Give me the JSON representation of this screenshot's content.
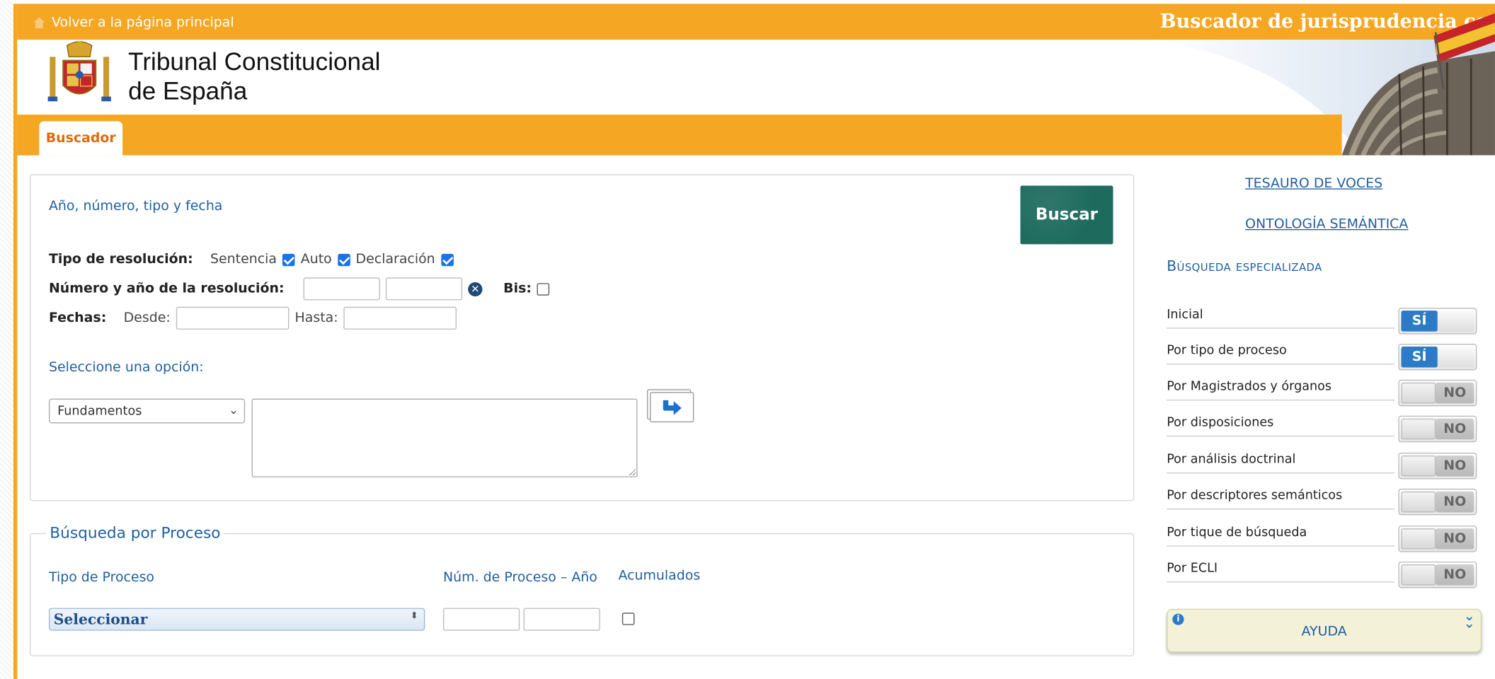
{
  "topbar": {
    "home_link": "Volver a la página principal",
    "title": "Buscador de jurisprudencia constitucional"
  },
  "header": {
    "org_line1": "Tribunal Constitucional",
    "org_line2": "de España"
  },
  "tabs": [
    {
      "label": "Buscador",
      "active": true
    }
  ],
  "main": {
    "section_title": "Año, número, tipo y fecha",
    "search_button": "Buscar",
    "tipo_resolucion": {
      "label": "Tipo de resolución:",
      "options": [
        {
          "label": "Sentencia",
          "checked": true
        },
        {
          "label": "Auto",
          "checked": true
        },
        {
          "label": "Declaración",
          "checked": true
        }
      ]
    },
    "numero_label": "Número y año de la resolución:",
    "bis_label": "Bis:",
    "fechas_label": "Fechas:",
    "desde_label": "Desde:",
    "hasta_label": "Hasta:",
    "seleccione_label": "Seleccione una opción:",
    "option_select_value": "Fundamentos"
  },
  "proceso": {
    "legend": "Búsqueda por Proceso",
    "tipo_label": "Tipo de Proceso",
    "num_label": "Núm. de Proceso – Año",
    "acumulados_label": "Acumulados",
    "tipo_select_value": "Seleccionar"
  },
  "sidebar": {
    "link_tesauro": "TESAURO DE VOCES",
    "link_ontologia": "ONTOLOGÍA SEMÁNTICA",
    "title": "Búsqueda especializada",
    "options": [
      {
        "label": "Inicial",
        "state": "SÍ",
        "on": true
      },
      {
        "label": "Por tipo de proceso",
        "state": "SÍ",
        "on": true
      },
      {
        "label": "Por Magistrados y órganos",
        "state": "NO",
        "on": false
      },
      {
        "label": "Por disposiciones",
        "state": "NO",
        "on": false
      },
      {
        "label": "Por análisis doctrinal",
        "state": "NO",
        "on": false
      },
      {
        "label": "Por descriptores semánticos",
        "state": "NO",
        "on": false
      },
      {
        "label": "Por tique de búsqueda",
        "state": "NO",
        "on": false
      },
      {
        "label": "Por ECLI",
        "state": "NO",
        "on": false
      }
    ],
    "ayuda_label": "AYUDA"
  },
  "colors": {
    "accent_orange": "#f5a623",
    "link_blue": "#1f5fa0",
    "button_green": "#1e6b5e",
    "toggle_on_blue": "#2b7bc6"
  }
}
